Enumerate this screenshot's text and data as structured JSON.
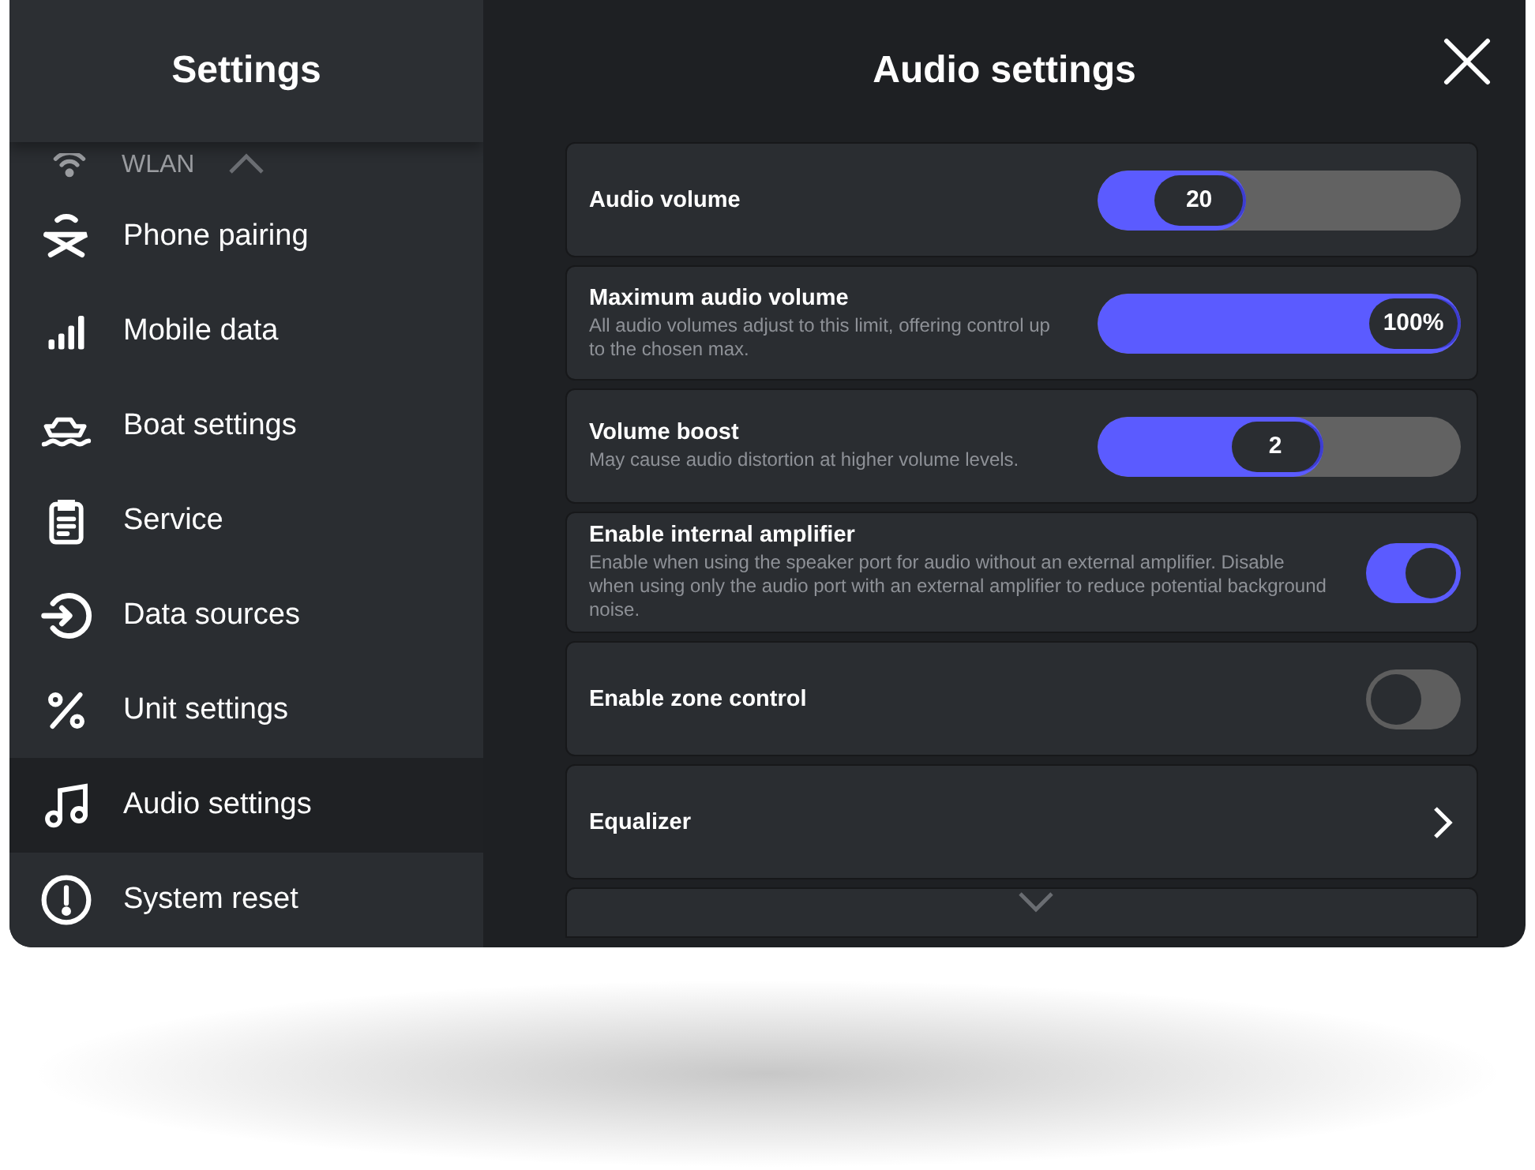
{
  "sidebar": {
    "title": "Settings",
    "partial_item": {
      "label": "WLAN"
    },
    "items": [
      {
        "label": "Phone pairing",
        "selected": false
      },
      {
        "label": "Mobile data",
        "selected": false
      },
      {
        "label": "Boat settings",
        "selected": false
      },
      {
        "label": "Service",
        "selected": false
      },
      {
        "label": "Data sources",
        "selected": false
      },
      {
        "label": "Unit settings",
        "selected": false
      },
      {
        "label": "Audio settings",
        "selected": true
      },
      {
        "label": "System reset",
        "selected": false
      }
    ]
  },
  "main": {
    "title": "Audio settings",
    "settings": [
      {
        "kind": "slider",
        "label": "Audio volume",
        "value": "20",
        "level": 0.41
      },
      {
        "kind": "slider",
        "label": "Maximum audio volume",
        "description": "All audio volumes adjust to this limit, offering control up to the chosen max.",
        "value": "100%",
        "level": 1
      },
      {
        "kind": "slider",
        "label": "Volume boost",
        "description": "May cause audio distortion at higher volume levels.",
        "value": "2",
        "level": 0.62
      },
      {
        "kind": "toggle",
        "label": "Enable internal amplifier",
        "description": "Enable when using the speaker port for audio without an external amplifier. Disable when using only the audio port with an external amplifier to reduce potential background noise.",
        "on": true
      },
      {
        "kind": "toggle",
        "label": "Enable zone control",
        "on": false
      },
      {
        "kind": "link",
        "label": "Equalizer"
      }
    ]
  }
}
